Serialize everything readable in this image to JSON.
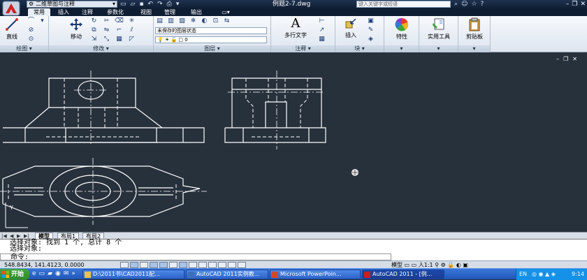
{
  "titlebar": {
    "workspace": "二维草图与注释",
    "doc_title": "例题2-7.dwg",
    "search_placeholder": "键入关键字或短语"
  },
  "tabs": [
    {
      "label": "常用",
      "active": true
    },
    {
      "label": "插入"
    },
    {
      "label": "注释"
    },
    {
      "label": "参数化"
    },
    {
      "label": "视图"
    },
    {
      "label": "管理"
    },
    {
      "label": "输出"
    }
  ],
  "ribbon": {
    "draw": {
      "title": "绘图",
      "line": "直线"
    },
    "modify": {
      "title": "修改",
      "move": "移动"
    },
    "layers": {
      "title": "图层",
      "state": "未保存的图层状态",
      "current": "0"
    },
    "annotation": {
      "title": "注释",
      "mtext": "多行文字"
    },
    "block": {
      "title": "块",
      "insert": "插入"
    },
    "properties": {
      "label": "特性"
    },
    "utilities": {
      "label": "实用工具"
    },
    "clipboard": {
      "label": "剪贴板"
    }
  },
  "layout_tabs": [
    "模型",
    "布局1",
    "布局2"
  ],
  "command": {
    "lines": [
      "选择对象: 找到 1 个, 总计 8 个",
      "选择对象:"
    ],
    "prompt": "命令:"
  },
  "status": {
    "coords": "548.8434, 141.4123, 0.0000",
    "model": "模型",
    "scale": "人1:1"
  },
  "taskbar": {
    "start": "开始",
    "items": [
      {
        "label": "D:\\2011书\\CAD2011配..."
      },
      {
        "label": "AutoCAD 2011实例教..."
      },
      {
        "label": "Microsoft PowerPoin..."
      },
      {
        "label": "AutoCAD 2011 - [例...",
        "active": true
      }
    ],
    "lang": "EN",
    "clock": "9:14"
  },
  "colors": {
    "canvas": "#27313c",
    "drawing_line": "#ffffff",
    "title_bar": "#0f1e33",
    "taskbar": "#2c63c8"
  }
}
